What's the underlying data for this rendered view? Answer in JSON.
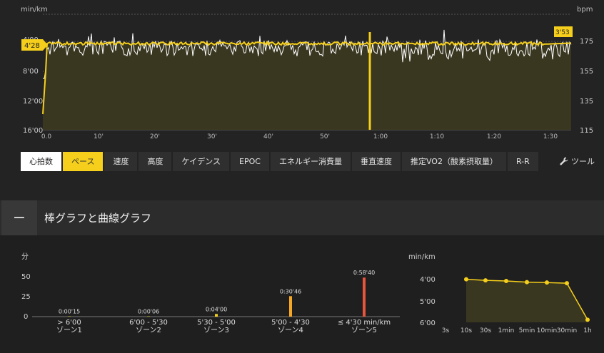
{
  "top_chart": {
    "left_unit": "min/km",
    "right_unit": "bpm",
    "y_left_ticks": [
      "4'00",
      "8'00",
      "12'00",
      "16'00"
    ],
    "y_right_ticks": [
      "175",
      "155",
      "135",
      "115"
    ],
    "x_ticks": [
      "0.0",
      "10'",
      "20'",
      "30'",
      "40'",
      "50'",
      "1:00",
      "1:10",
      "1:20",
      "1:30"
    ],
    "start_label": "4'28",
    "end_label": "3'53",
    "pace_color": "#f5cf1b",
    "hr_color": "#ffffff"
  },
  "tabs": [
    {
      "label": "心拍数",
      "state": "active-hr"
    },
    {
      "label": "ペース",
      "state": "active-pace"
    },
    {
      "label": "速度"
    },
    {
      "label": "高度"
    },
    {
      "label": "ケイデンス"
    },
    {
      "label": "EPOC"
    },
    {
      "label": "エネルギー消費量"
    },
    {
      "label": "垂直速度"
    },
    {
      "label": "推定VO2（酸素摂取量）"
    },
    {
      "label": "R-R"
    }
  ],
  "tools_label": "ツール",
  "tools_icon": "wrench-icon",
  "section": {
    "collapse_symbol": "−",
    "title": "棒グラフと曲線グラフ"
  },
  "chart_data": [
    {
      "type": "bar",
      "ylabel": "分",
      "ylim": [
        0,
        60
      ],
      "y_ticks": [
        "50",
        "25",
        "0"
      ],
      "categories": [
        "> 6'00",
        "6'00 - 5'30",
        "5'30 - 5'00",
        "5'00 - 4'30",
        "≤ 4'30 min/km"
      ],
      "zones": [
        "ゾーン1",
        "ゾーン2",
        "ゾーン3",
        "ゾーン4",
        "ゾーン5"
      ],
      "values": [
        0.25,
        0.1,
        4.0,
        30.77,
        58.67
      ],
      "value_labels": [
        "0:00'15",
        "0:00'06",
        "0:04'00",
        "0:30'46",
        "0:58'40"
      ],
      "colors": [
        "#f5cf1b",
        "#f5cf1b",
        "#f5cf1b",
        "#f5a623",
        "#e8543c"
      ]
    },
    {
      "type": "line",
      "ylabel": "min/km",
      "y_ticks": [
        "4'00",
        "5'00",
        "6'00"
      ],
      "ylim": [
        6.0,
        4.0
      ],
      "x_ticks": [
        "3s",
        "10s",
        "30s",
        "1min",
        "5min",
        "10min",
        "30min",
        "1h"
      ],
      "x": [
        "10s",
        "30s",
        "1min",
        "5min",
        "10min",
        "30min",
        "1h"
      ],
      "values": [
        4.02,
        4.07,
        4.1,
        4.15,
        4.17,
        4.2,
        5.88
      ],
      "color": "#f5cf1b"
    }
  ]
}
